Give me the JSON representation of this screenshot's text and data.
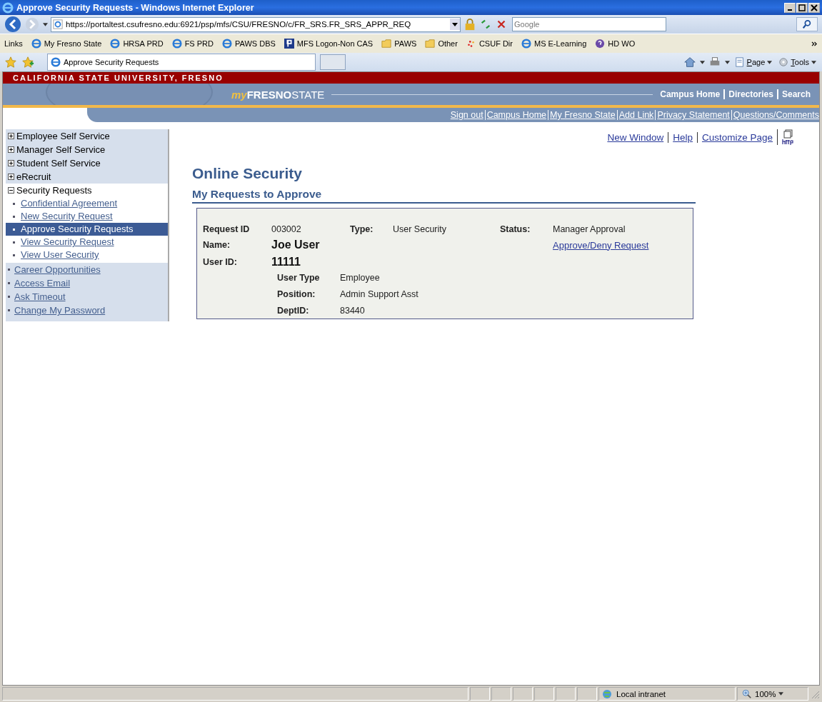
{
  "window": {
    "title": "Approve Security Requests - Windows Internet Explorer"
  },
  "address_bar": {
    "url": "https://portaltest.csufresno.edu:6921/psp/mfs/CSU/FRESNO/c/FR_SRS.FR_SRS_APPR_REQ"
  },
  "search": {
    "placeholder": "Google"
  },
  "links_bar": {
    "label": "Links",
    "items": [
      {
        "label": "My Fresno State",
        "kind": "ie"
      },
      {
        "label": "HRSA PRD",
        "kind": "ie"
      },
      {
        "label": "FS PRD",
        "kind": "ie"
      },
      {
        "label": "PAWS DBS",
        "kind": "ie"
      },
      {
        "label": "MFS Logon-Non CAS",
        "kind": "p"
      },
      {
        "label": "PAWS",
        "kind": "folder"
      },
      {
        "label": "Other",
        "kind": "folder"
      },
      {
        "label": "CSUF Dir",
        "kind": "dots"
      },
      {
        "label": "MS E-Learning",
        "kind": "ie"
      },
      {
        "label": "HD WO",
        "kind": "help"
      }
    ]
  },
  "tab": {
    "label": "Approve Security Requests"
  },
  "command_bar": [
    "Page",
    "Tools"
  ],
  "banner": {
    "title": "CALIFORNIA STATE UNIVERSITY, FRESNO",
    "logo": [
      "my",
      "FRESNO",
      "STATE"
    ],
    "top_links": [
      "Campus Home",
      "Directories",
      "Search"
    ]
  },
  "nav_links": [
    "Sign out",
    "Campus Home",
    "My Fresno State",
    "Add Link",
    "Privacy Statement",
    "Questions/Comments"
  ],
  "sidebar": {
    "items": [
      {
        "label": "Employee Self Service",
        "kind": "folder",
        "expanded": false
      },
      {
        "label": "Manager Self Service",
        "kind": "folder",
        "expanded": false
      },
      {
        "label": "Student Self Service",
        "kind": "folder",
        "expanded": false
      },
      {
        "label": "eRecruit",
        "kind": "folder",
        "expanded": false
      },
      {
        "label": "Security Requests",
        "kind": "folder",
        "expanded": true,
        "children": [
          {
            "label": "Confidential Agreement",
            "selected": false
          },
          {
            "label": "New Security Request",
            "selected": false
          },
          {
            "label": "Approve Security Requests",
            "selected": true
          },
          {
            "label": "View Security Request",
            "selected": false
          },
          {
            "label": "View User Security",
            "selected": false
          }
        ]
      },
      {
        "label": "Career Opportunities",
        "kind": "link"
      },
      {
        "label": "Access Email",
        "kind": "link"
      },
      {
        "label": "Ask Timeout",
        "kind": "link"
      },
      {
        "label": "Change My Password",
        "kind": "link"
      }
    ]
  },
  "page_links": [
    "New Window",
    "Help",
    "Customize Page"
  ],
  "heading": "Online Security",
  "subheading": "My Requests to Approve",
  "request": {
    "request_id": {
      "label": "Request ID",
      "value": "003002"
    },
    "type": {
      "label": "Type:",
      "value": "User Security"
    },
    "status": {
      "label": "Status:",
      "value": "Manager Approval"
    },
    "name": {
      "label": "Name:",
      "value": "Joe User"
    },
    "action_link": "Approve/Deny Request",
    "user_id": {
      "label": "User ID:",
      "value": "11111"
    },
    "details": [
      {
        "label": "User Type",
        "value": "Employee"
      },
      {
        "label": "Position:",
        "value": "Admin Support Asst"
      },
      {
        "label": "DeptID:",
        "value": "83440"
      }
    ]
  },
  "status_bar": {
    "zone": "Local intranet",
    "zoom": "100%"
  }
}
